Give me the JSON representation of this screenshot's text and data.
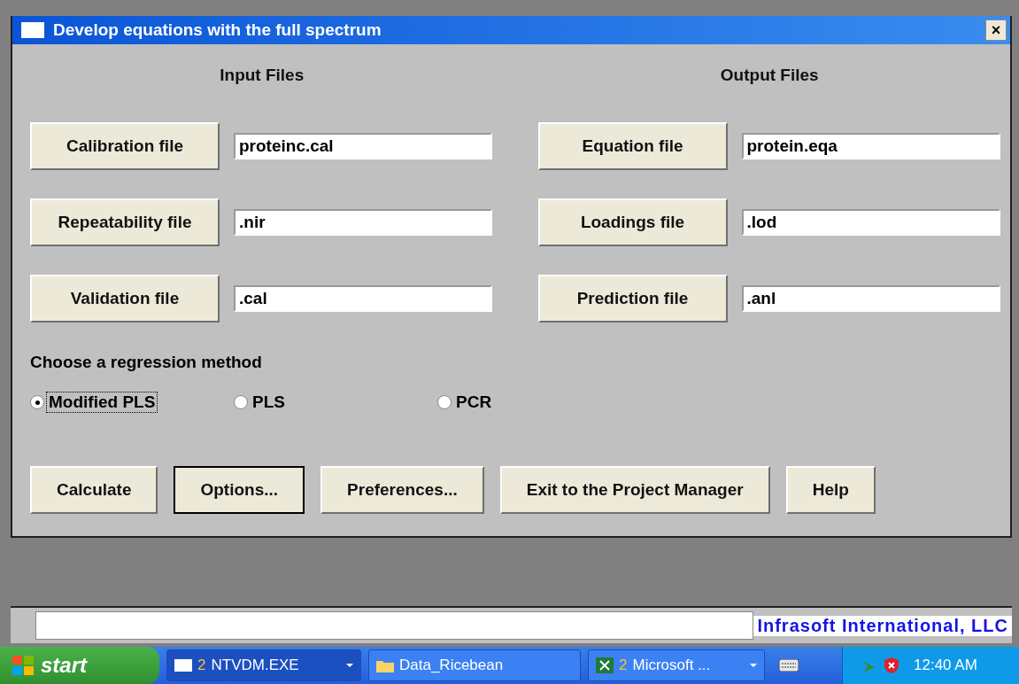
{
  "window": {
    "title": "Develop equations with the full spectrum",
    "close": "×"
  },
  "input_files": {
    "heading": "Input Files",
    "rows": [
      {
        "button": "Calibration file",
        "value": "proteinc.cal"
      },
      {
        "button": "Repeatability file",
        "value": ".nir"
      },
      {
        "button": "Validation file",
        "value": ".cal"
      }
    ]
  },
  "output_files": {
    "heading": "Output Files",
    "rows": [
      {
        "button": "Equation file",
        "value": "protein.eqa"
      },
      {
        "button": "Loadings file",
        "value": ".lod"
      },
      {
        "button": "Prediction file",
        "value": ".anl"
      }
    ]
  },
  "regression": {
    "label": "Choose a regression method",
    "options": [
      {
        "label": "Modified PLS",
        "selected": true
      },
      {
        "label": "PLS",
        "selected": false
      },
      {
        "label": "PCR",
        "selected": false
      }
    ]
  },
  "buttons": [
    {
      "label": "Calculate",
      "default": false
    },
    {
      "label": "Options...",
      "default": true
    },
    {
      "label": "Preferences...",
      "default": false
    },
    {
      "label": "Exit to the Project Manager",
      "default": false
    },
    {
      "label": "Help",
      "default": false
    }
  ],
  "status_bar": {
    "company": "Infrasoft International, LLC"
  },
  "taskbar": {
    "start": "start",
    "tasks": [
      {
        "kind": "window",
        "count": "2",
        "label": "NTVDM.EXE",
        "selected": true,
        "grouped": true
      },
      {
        "kind": "folder",
        "label": "Data_Ricebean",
        "selected": false,
        "grouped": false
      },
      {
        "kind": "excel",
        "count": "2",
        "label": "Microsoft ...",
        "selected": false,
        "grouped": true
      }
    ],
    "clock": "12:40 AM"
  }
}
